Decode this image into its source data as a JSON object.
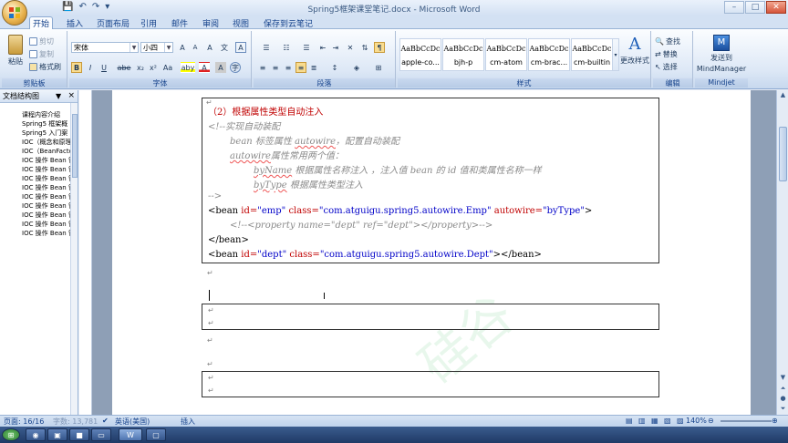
{
  "window": {
    "title": "Spring5框架课堂笔记.docx - Microsoft Word",
    "minimize": "–",
    "maximize": "□",
    "close": "✕"
  },
  "qat": {
    "save": "💾",
    "undo": "↶",
    "redo": "↷",
    "more": "▾"
  },
  "tabs": [
    {
      "label": "开始",
      "active": true
    },
    {
      "label": "插入"
    },
    {
      "label": "页面布局"
    },
    {
      "label": "引用"
    },
    {
      "label": "邮件"
    },
    {
      "label": "审阅"
    },
    {
      "label": "视图"
    },
    {
      "label": "保存到云笔记"
    }
  ],
  "ribbon": {
    "clipboard": {
      "label": "剪贴板",
      "paste": "粘贴",
      "cut": "剪切",
      "copy": "复制",
      "format_painter": "格式刷"
    },
    "font": {
      "label": "字体",
      "font_name": "宋体",
      "font_size": "小四",
      "bold": "B",
      "italic": "I",
      "underline": "U",
      "strike": "abe",
      "sub": "x₂",
      "sup": "x²",
      "case": "Aa",
      "grow": "A",
      "shrink": "A",
      "clear": "A",
      "wen": "文",
      "border_a": "A",
      "highlight": "aby",
      "font_color": "A",
      "char_shade": "A",
      "enclose": "字"
    },
    "paragraph": {
      "label": "段落"
    },
    "styles": {
      "label": "样式",
      "items": [
        {
          "sample": "AaBbCcDc",
          "name": "apple-co..."
        },
        {
          "sample": "AaBbCcDc",
          "name": "bjh-p"
        },
        {
          "sample": "AaBbCcDc",
          "name": "cm-atom"
        },
        {
          "sample": "AaBbCcDc",
          "name": "cm-brac..."
        },
        {
          "sample": "AaBbCcDc",
          "name": "cm-builtin"
        }
      ],
      "change_styles": "更改样式"
    },
    "editing": {
      "label": "编辑",
      "find": "查找",
      "replace": "替换",
      "select": "选择"
    },
    "mindjet": {
      "label": "Mindjet",
      "send": "发送到",
      "app": "MindManager"
    }
  },
  "nav_pane": {
    "title": "文档结构图",
    "close": "×",
    "items": [
      "课程内容介绍",
      "Spring5 框架概",
      "Spring5 入门案",
      "IOC（概念和原理",
      "IOC（BeanFacto",
      "IOC 操作 Bean 管",
      "IOC 操作 Bean 管",
      "IOC 操作 Bean 管",
      "IOC 操作 Bean 管",
      "IOC 操作 Bean 管",
      "IOC 操作 Bean 管",
      "IOC 操作 Bean 管",
      "IOC 操作 Bean 管",
      "IOC 操作 Bean 管"
    ]
  },
  "document": {
    "heading": "（2）根据属性类型自动注入",
    "comment_open": "<!--实现自动装配",
    "line1_a": "bean 标签属性 ",
    "line1_b": "autowire",
    "line1_c": "，配置自动装配",
    "line2_a": "autowire",
    "line2_b": "属性常用两个值：",
    "line3_a": "byName",
    "line3_b": " 根据属性名称注入 ，注入值 bean 的 id 值和类属性名称一样",
    "line4_a": "byType",
    "line4_b": " 根据属性类型注入",
    "comment_close": "-->",
    "bean1": {
      "open": "<bean ",
      "id_attr": "id=",
      "id_val": "\"emp\"",
      "class_attr": " class=",
      "class_val": "\"com.atguigu.spring5.autowire.Emp\"",
      "aw_attr": " autowire=",
      "aw_val": "\"byType\"",
      "close": ">"
    },
    "property_comment": "<!--<property name=\"dept\" ref=\"dept\"></property>-->",
    "bean1_end": "</bean>",
    "bean2": {
      "open": "<bean ",
      "id_attr": "id=",
      "id_val": "\"dept\"",
      "class_attr": " class=",
      "class_val": "\"com.atguigu.spring5.autowire.Dept\"",
      "close": "></bean>"
    },
    "para_mark": "↵",
    "watermark": "硅谷"
  },
  "status": {
    "page": "页面: 16/16",
    "words": "字数: 13,781",
    "language": "英语(美国)",
    "mode": "插入",
    "zoom": "140%"
  }
}
